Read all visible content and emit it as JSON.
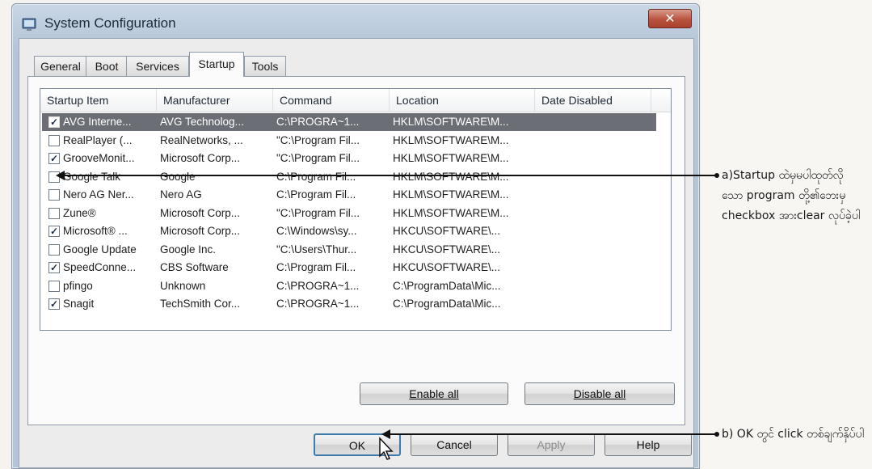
{
  "window": {
    "title": "System Configuration",
    "close_label": "✕"
  },
  "tabs": [
    "General",
    "Boot",
    "Services",
    "Startup",
    "Tools"
  ],
  "active_tab": "Startup",
  "listview": {
    "columns": [
      "Startup Item",
      "Manufacturer",
      "Command",
      "Location",
      "Date Disabled"
    ],
    "rows": [
      {
        "checked": true,
        "item": "AVG Interne...",
        "manufacturer": "AVG Technolog...",
        "command": "C:\\PROGRA~1...",
        "location": "HKLM\\SOFTWARE\\M...",
        "date": "",
        "selected": true
      },
      {
        "checked": false,
        "item": "RealPlayer (...",
        "manufacturer": "RealNetworks, ...",
        "command": "\"C:\\Program Fil...",
        "location": "HKLM\\SOFTWARE\\M...",
        "date": ""
      },
      {
        "checked": true,
        "item": "GrooveMonit...",
        "manufacturer": "Microsoft Corp...",
        "command": "\"C:\\Program Fil...",
        "location": "HKLM\\SOFTWARE\\M...",
        "date": ""
      },
      {
        "checked": false,
        "item": "Google Talk",
        "manufacturer": "Google",
        "command": "C:\\Program Fil...",
        "location": "HKLM\\SOFTWARE\\M...",
        "date": ""
      },
      {
        "checked": false,
        "item": "Nero AG Ner...",
        "manufacturer": "Nero AG",
        "command": "C:\\Program Fil...",
        "location": "HKLM\\SOFTWARE\\M...",
        "date": ""
      },
      {
        "checked": false,
        "item": "Zune®",
        "manufacturer": "Microsoft Corp...",
        "command": "\"C:\\Program Fil...",
        "location": "HKLM\\SOFTWARE\\M...",
        "date": ""
      },
      {
        "checked": true,
        "item": "Microsoft® ...",
        "manufacturer": "Microsoft Corp...",
        "command": "C:\\Windows\\sy...",
        "location": "HKCU\\SOFTWARE\\...",
        "date": ""
      },
      {
        "checked": false,
        "item": "Google Update",
        "manufacturer": "Google Inc.",
        "command": "\"C:\\Users\\Thur...",
        "location": "HKCU\\SOFTWARE\\...",
        "date": ""
      },
      {
        "checked": true,
        "item": "SpeedConne...",
        "manufacturer": "CBS Software",
        "command": "C:\\Program Fil...",
        "location": "HKCU\\SOFTWARE\\...",
        "date": ""
      },
      {
        "checked": false,
        "item": "pfingo",
        "manufacturer": "Unknown",
        "command": "C:\\PROGRA~1...",
        "location": "C:\\ProgramData\\Mic...",
        "date": ""
      },
      {
        "checked": true,
        "item": "Snagit",
        "manufacturer": "TechSmith Cor...",
        "command": "C:\\PROGRA~1...",
        "location": "C:\\ProgramData\\Mic...",
        "date": ""
      }
    ]
  },
  "buttons": {
    "enable_all": "Enable all",
    "disable_all": "Disable all",
    "ok": "OK",
    "cancel": "Cancel",
    "apply": "Apply",
    "help": "Help"
  },
  "annotations": {
    "a": "a)Startup ထဲမှမပါထုတ်လိုသော program တို့၏ဘေးမှ checkbox အားclear လုပ်ခဲ့ပါ",
    "b": "b) OK တွင် click တစ်ချက်နှိပ်ပါ"
  },
  "colors": {
    "selected_row": "#6b6f75",
    "title_bar": "#b9c9db",
    "close_button": "#b9533f"
  }
}
